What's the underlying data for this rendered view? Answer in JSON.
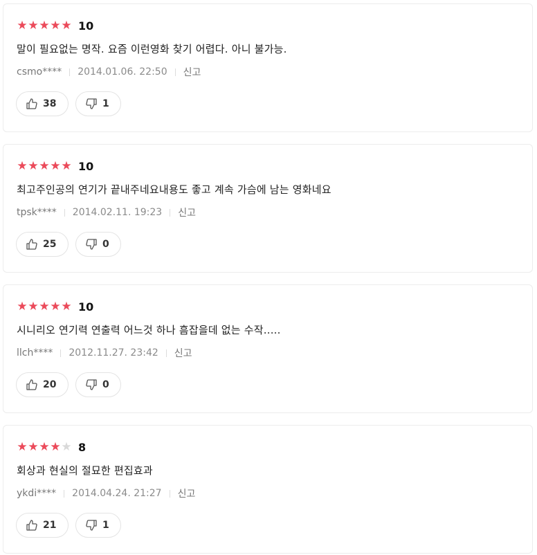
{
  "reviews": [
    {
      "stars_filled": 5,
      "stars_total": 5,
      "score": "10",
      "comment": "말이 필요없는 명작. 요즘 이런영화 찾기 어렵다. 아니 불가능.",
      "user": "csmo****",
      "date": "2014.01.06. 22:50",
      "report_label": "신고",
      "likes": "38",
      "dislikes": "1"
    },
    {
      "stars_filled": 5,
      "stars_total": 5,
      "score": "10",
      "comment": "최고주인공의 연기가 끝내주네요내용도 좋고 계속 가슴에 남는 영화네요",
      "user": "tpsk****",
      "date": "2014.02.11. 19:23",
      "report_label": "신고",
      "likes": "25",
      "dislikes": "0"
    },
    {
      "stars_filled": 5,
      "stars_total": 5,
      "score": "10",
      "comment": "시니리오 연기력 연출력 어느것 하나 흠잡을데 없는 수작.....",
      "user": "llch****",
      "date": "2012.11.27. 23:42",
      "report_label": "신고",
      "likes": "20",
      "dislikes": "0"
    },
    {
      "stars_filled": 4,
      "stars_total": 5,
      "score": "8",
      "comment": "회상과 현실의 절묘한 편집효과",
      "user": "ykdi****",
      "date": "2014.04.24. 21:27",
      "report_label": "신고",
      "likes": "21",
      "dislikes": "1"
    }
  ],
  "icons": {
    "like": "thumbs-up-icon",
    "dislike": "thumbs-down-icon",
    "star": "star-icon"
  },
  "colors": {
    "star_on": "#eb4a5a",
    "star_off": "#d9d9d9"
  }
}
